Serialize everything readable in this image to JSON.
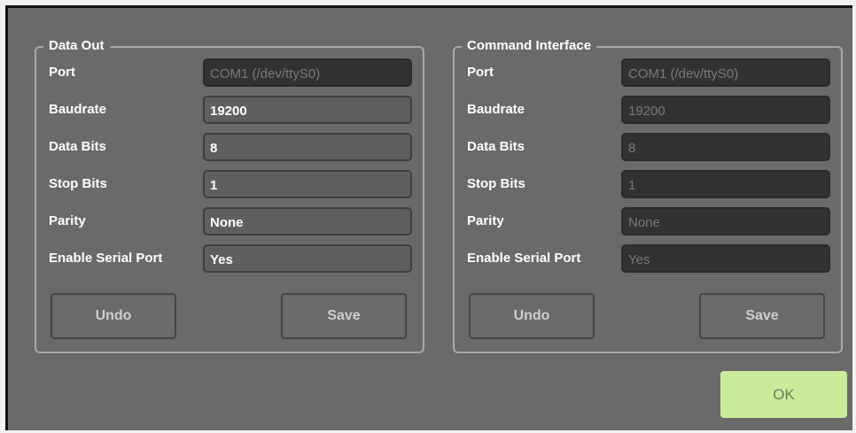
{
  "data_out": {
    "title": "Data Out",
    "rows": [
      {
        "label": "Port",
        "value": "COM1 (/dev/ttyS0)"
      },
      {
        "label": "Baudrate",
        "value": "19200"
      },
      {
        "label": "Data Bits",
        "value": "8"
      },
      {
        "label": "Stop Bits",
        "value": "1"
      },
      {
        "label": "Parity",
        "value": "None"
      },
      {
        "label": "Enable Serial Port",
        "value": "Yes"
      }
    ],
    "undo_label": "Undo",
    "save_label": "Save"
  },
  "command_interface": {
    "title": "Command Interface",
    "rows": [
      {
        "label": "Port",
        "value": "COM1 (/dev/ttyS0)"
      },
      {
        "label": "Baudrate",
        "value": "19200"
      },
      {
        "label": "Data Bits",
        "value": "8"
      },
      {
        "label": "Stop Bits",
        "value": "1"
      },
      {
        "label": "Parity",
        "value": "None"
      },
      {
        "label": "Enable Serial Port",
        "value": "Yes"
      }
    ],
    "undo_label": "Undo",
    "save_label": "Save"
  },
  "ok_label": "OK",
  "colors": {
    "background": "#6a6a6a",
    "ok_button": "#c9ec9a",
    "readonly_field": "#323232",
    "editable_field": "#5f5f5f"
  }
}
